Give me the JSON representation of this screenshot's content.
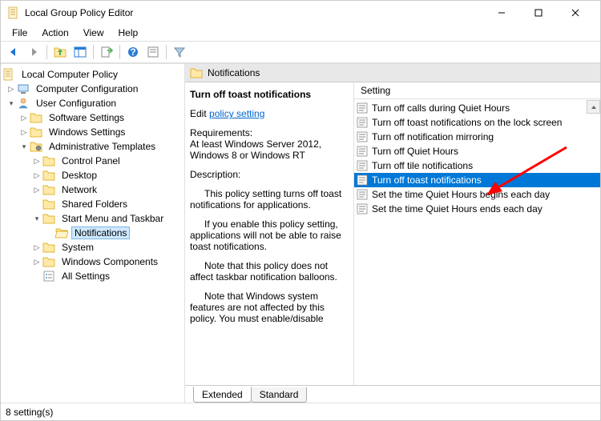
{
  "window": {
    "title": "Local Group Policy Editor"
  },
  "menus": {
    "file": "File",
    "action": "Action",
    "view": "View",
    "help": "Help"
  },
  "tree": {
    "root": "Local Computer Policy",
    "cc": "Computer Configuration",
    "uc": "User Configuration",
    "ss": "Software Settings",
    "ws": "Windows Settings",
    "at": "Administrative Templates",
    "cp": "Control Panel",
    "dt": "Desktop",
    "nw": "Network",
    "sf": "Shared Folders",
    "smt": "Start Menu and Taskbar",
    "notif": "Notifications",
    "sys": "System",
    "wc": "Windows Components",
    "all": "All Settings"
  },
  "header": {
    "folder": "Notifications"
  },
  "detail": {
    "title": "Turn off toast notifications",
    "edit_prefix": "Edit ",
    "edit_link": "policy setting",
    "req_label": "Requirements:",
    "req_text_1": "At least Windows Server 2012,",
    "req_text_2": "Windows 8 or Windows RT",
    "desc_label": "Description:",
    "desc_p1": "This policy setting turns off toast notifications for applications.",
    "desc_p2": "If you enable this policy setting, applications will not be able to raise toast notifications.",
    "desc_p3": "Note that this policy does not affect taskbar notification balloons.",
    "desc_p4": "Note that Windows system features are not affected by this policy.  You must enable/disable"
  },
  "list": {
    "header": "Setting",
    "items": [
      "Turn off calls during Quiet Hours",
      "Turn off toast notifications on the lock screen",
      "Turn off notification mirroring",
      "Turn off Quiet Hours",
      "Turn off tile notifications",
      "Turn off toast notifications",
      "Set the time Quiet Hours begins each day",
      "Set the time Quiet Hours ends each day"
    ],
    "selected_index": 5
  },
  "tabs": {
    "extended": "Extended",
    "standard": "Standard"
  },
  "status": {
    "text": "8 setting(s)"
  }
}
